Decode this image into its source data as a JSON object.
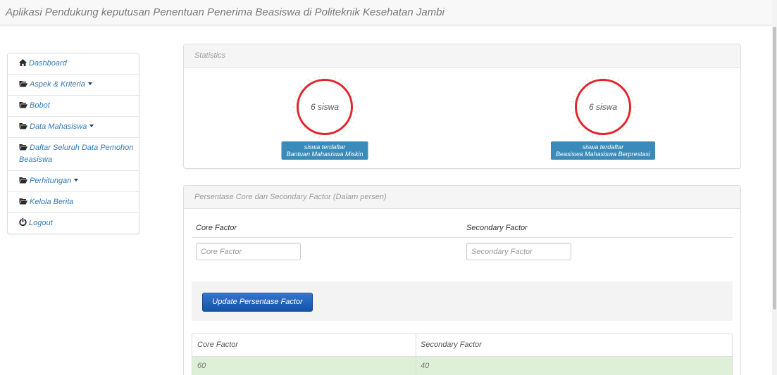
{
  "app": {
    "title": "Aplikasi Pendukung keputusan Penentuan Penerima Beasiswa di Politeknik Kesehatan Jambi"
  },
  "sidebar": {
    "items": [
      {
        "label": "Dashboard",
        "icon": "home-icon",
        "dropdown": false
      },
      {
        "label": "Aspek & Kriteria",
        "icon": "folder-open-icon",
        "dropdown": true
      },
      {
        "label": "Bobot",
        "icon": "folder-open-icon",
        "dropdown": false
      },
      {
        "label": "Data Mahasiswa",
        "icon": "folder-open-icon",
        "dropdown": true
      },
      {
        "label": "Daftar Seluruh Data Pemohon Beasiswa",
        "icon": "folder-open-icon",
        "dropdown": false
      },
      {
        "label": "Perhitungan",
        "icon": "folder-open-icon",
        "dropdown": true
      },
      {
        "label": "Kelola Berita",
        "icon": "folder-open-icon",
        "dropdown": false
      },
      {
        "label": "Logout",
        "icon": "power-icon",
        "dropdown": false
      }
    ]
  },
  "statistics": {
    "title": "Statistics",
    "gauges": [
      {
        "value_text": "6 siswa",
        "ring_fill": 1,
        "label_line1": "siswa terdaftar",
        "label_line2": "Bantuan Mahasiswa Miskin"
      },
      {
        "value_text": "6 siswa",
        "ring_fill": 1,
        "label_line1": "siswa terdaftar",
        "label_line2": "Beasiswa Mahasiswa Berprestasi"
      }
    ]
  },
  "factor_panel": {
    "title": "Persentase Core dan Secondary Factor (Dalam persen)",
    "form": {
      "core_label": "Core Factor",
      "secondary_label": "Secondary Factor",
      "core_input": {
        "value": "",
        "placeholder": "Core Factor"
      },
      "secondary_input": {
        "value": "",
        "placeholder": "Secondary Factor"
      },
      "submit_label": "Update Persentase Factor"
    },
    "table": {
      "headers": [
        "Core Factor",
        "Secondary Factor"
      ],
      "rows": [
        [
          "60",
          "40"
        ]
      ]
    }
  },
  "colors": {
    "link": "#337ab7",
    "gauge_ring": "#e1262e",
    "gauge_label": "#3b8bba",
    "primary_button": "#1761c6",
    "success_row": "#dff0d8"
  }
}
